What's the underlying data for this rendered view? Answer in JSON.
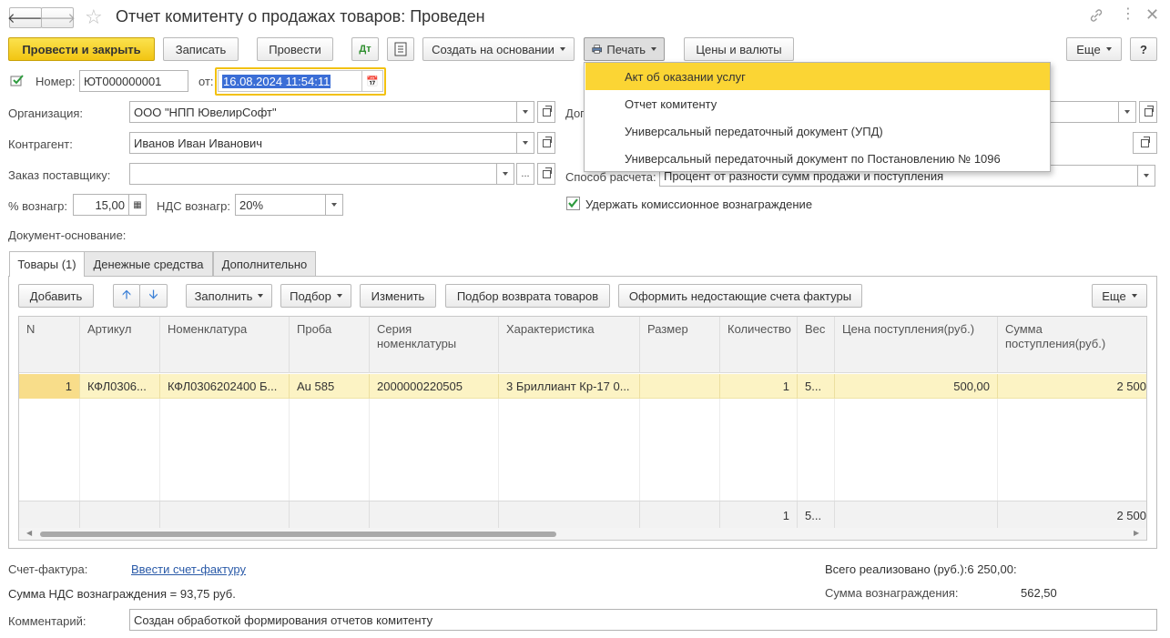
{
  "window": {
    "title": "Отчет комитенту о продажах товаров: Проведен"
  },
  "toolbar": {
    "post_close": "Провести и закрыть",
    "save": "Записать",
    "post": "Провести",
    "create_based": "Создать на основании",
    "print": "Печать",
    "prices_currencies": "Цены и валюты",
    "more": "Еще",
    "help": "?"
  },
  "print_menu": {
    "items": [
      {
        "label": "Акт об оказании услуг"
      },
      {
        "label": "Отчет комитенту"
      },
      {
        "label": "Универсальный передаточный документ (УПД)"
      },
      {
        "label": "Универсальный передаточный документ по Постановлению № 1096"
      }
    ]
  },
  "header": {
    "number_label": "Номер:",
    "number_value": "ЮТ000000001",
    "date_label": "от:",
    "date_value": "16.08.2024 11:54:11",
    "organization_label": "Организация:",
    "organization_value": "ООО \"НПП ЮвелирСофт\"",
    "contractor_label": "Контрагент:",
    "contractor_value": "Иванов Иван Иванович",
    "supplier_order_label": "Заказ поставщику:",
    "supplier_order_value": "",
    "reward_pct_label": "% вознагр:",
    "reward_pct_value": "15,00",
    "vat_reward_label": "НДС вознагр:",
    "vat_reward_value": "20%",
    "contract_label_partial": "Дог",
    "payment_method_label": "Способ расчета:",
    "payment_method_value": "Процент от разности сумм продажи и поступления",
    "hold_commission_label": "Удержать комиссионное вознаграждение",
    "hold_commission_checked": true,
    "base_document_label": "Документ-основание:"
  },
  "tabs": [
    {
      "label": "Товары (1)",
      "active": true
    },
    {
      "label": "Денежные средства",
      "active": false
    },
    {
      "label": "Дополнительно",
      "active": false
    }
  ],
  "table_toolbar": {
    "add": "Добавить",
    "fill": "Заполнить",
    "selection": "Подбор",
    "change": "Изменить",
    "return_selection": "Подбор возврата товаров",
    "invoices": "Оформить недостающие счета фактуры",
    "more": "Еще"
  },
  "table": {
    "columns": [
      "N",
      "Артикул",
      "Номенклатура",
      "Проба",
      "Серия номенклатуры",
      "Характеристика",
      "Размер",
      "Количество",
      "Вес",
      "Цена поступления(руб.)",
      "Сумма поступления(руб.)"
    ],
    "rows": [
      [
        "1",
        "КФЛ0306...",
        "КФЛ0306202400 Б...",
        "Au 585",
        "2000000220505",
        "3 Бриллиант Кр-17 0...",
        "",
        "1",
        "5...",
        "500,00",
        "2 500"
      ]
    ],
    "footer": {
      "quantity": "1",
      "weight": "5...",
      "sum": "2 500"
    }
  },
  "bottom": {
    "invoice_label": "Счет-фактура:",
    "invoice_link": "Ввести счет-фактуру",
    "vat_reward_text": "Сумма НДС вознаграждения = 93,75 руб.",
    "total_sold": "Всего реализовано (руб.):6 250,00:",
    "reward_sum_label": "Сумма вознаграждения:",
    "reward_sum_value": "562,50",
    "comment_label": "Комментарий:",
    "comment_value": "Создан обработкой формирования отчетов комитенту"
  }
}
